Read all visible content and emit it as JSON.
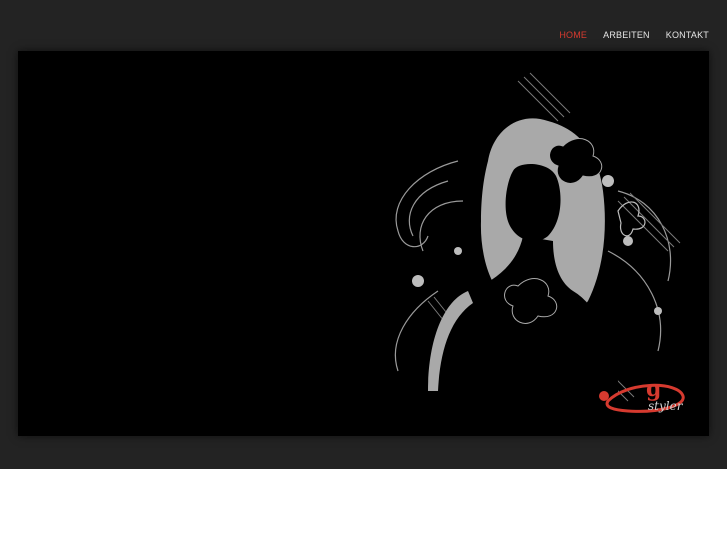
{
  "nav": {
    "items": [
      {
        "label": "HOME",
        "active": true
      },
      {
        "label": "ARBEITEN",
        "active": false
      },
      {
        "label": "KONTAKT",
        "active": false
      }
    ],
    "active_color": "#d63a2f"
  },
  "hero": {
    "logo_text": "styler",
    "logo_mark": "g",
    "colors": {
      "background": "#000000",
      "silhouette": "#a9a9a9",
      "accent": "#d63a2f"
    }
  }
}
